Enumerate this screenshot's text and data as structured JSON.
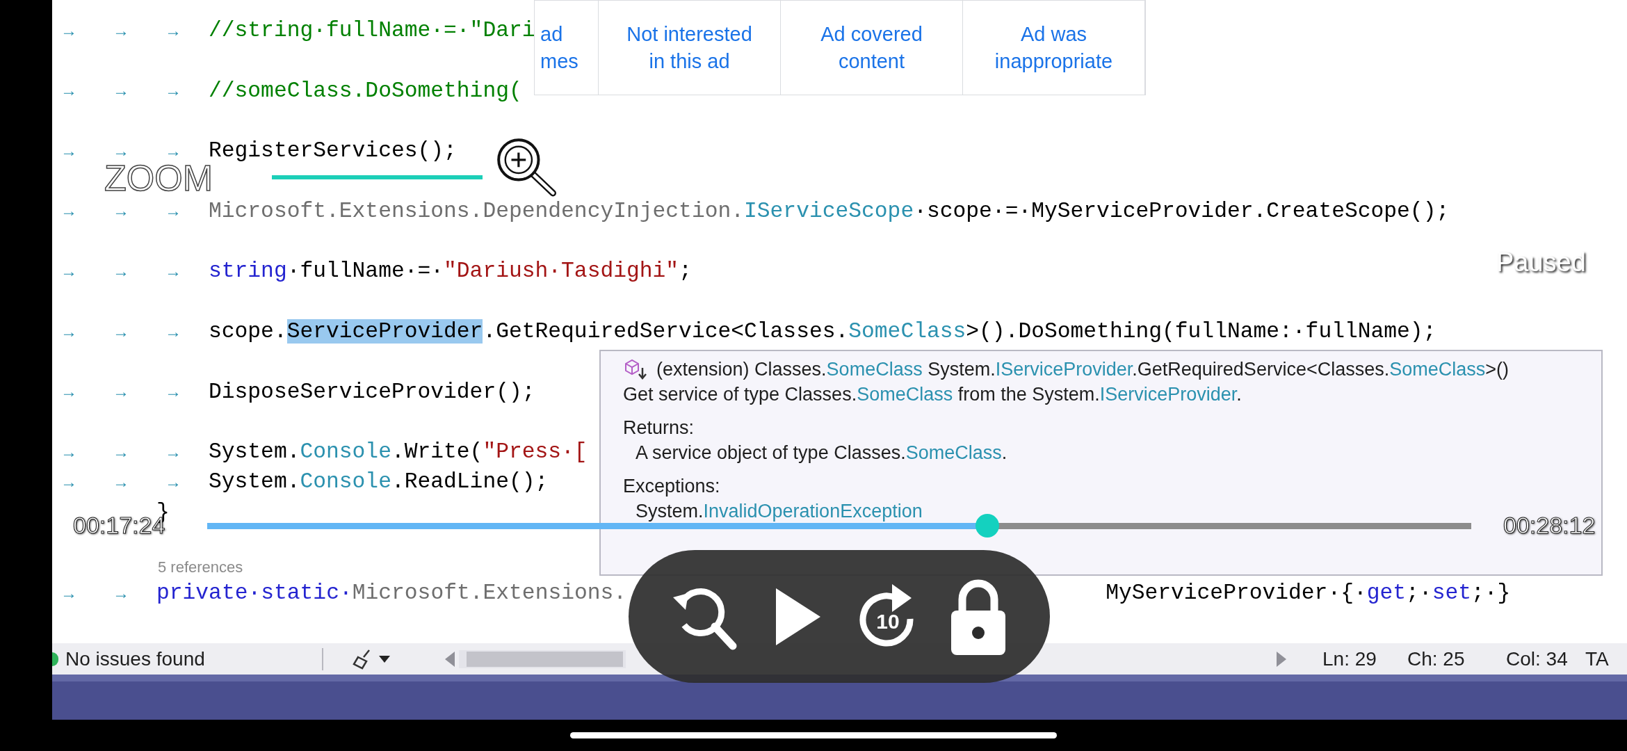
{
  "ad_feedback": {
    "options": [
      {
        "label": "ad\nmes"
      },
      {
        "label": "Not interested\nin this ad"
      },
      {
        "label": "Ad covered\ncontent"
      },
      {
        "label": "Ad was\ninappropriate"
      }
    ]
  },
  "overlay": {
    "zoom_label": "ZOOM",
    "status": "Paused"
  },
  "editor": {
    "lines": [
      {
        "kind": "code",
        "tabs": [
          "→",
          "→",
          "→"
        ],
        "segments": [
          {
            "kind": "comment",
            "text": "//string·fullName·=·\"Dari"
          }
        ]
      },
      {
        "kind": "blank"
      },
      {
        "kind": "code",
        "tabs": [
          "→",
          "→",
          "→"
        ],
        "segments": [
          {
            "kind": "comment",
            "text": "//someClass.DoSomething("
          }
        ]
      },
      {
        "kind": "blank"
      },
      {
        "kind": "code",
        "tabs": [
          "→",
          "→",
          "→"
        ],
        "segments": [
          {
            "kind": "plain",
            "text": "RegisterServices();"
          }
        ]
      },
      {
        "kind": "blank"
      },
      {
        "kind": "code",
        "tabs": [
          "→",
          "→",
          "→"
        ],
        "segments": [
          {
            "kind": "dim",
            "text": "Microsoft.Extensions.DependencyInjection."
          },
          {
            "kind": "type",
            "text": "IServiceScope"
          },
          {
            "kind": "plain",
            "text": "·scope·=·MyServiceProvider.CreateScope();"
          }
        ]
      },
      {
        "kind": "blank"
      },
      {
        "kind": "code",
        "tabs": [
          "→",
          "→",
          "→"
        ],
        "segments": [
          {
            "kind": "keyword",
            "text": "string"
          },
          {
            "kind": "plain",
            "text": "·fullName·=·"
          },
          {
            "kind": "string",
            "text": "\"Dariush·Tasdighi\""
          },
          {
            "kind": "plain",
            "text": ";"
          }
        ]
      },
      {
        "kind": "blank"
      },
      {
        "kind": "code",
        "tabs": [
          "→",
          "→",
          "→"
        ],
        "segments": [
          {
            "kind": "plain",
            "text": "scope."
          },
          {
            "kind": "selected",
            "text": "ServiceProvider"
          },
          {
            "kind": "plain",
            "text": ".GetRequiredService<Classes."
          },
          {
            "kind": "type",
            "text": "SomeClass"
          },
          {
            "kind": "plain",
            "text": ">().DoSomething(fullName:·fullName);"
          }
        ]
      },
      {
        "kind": "blank"
      },
      {
        "kind": "code",
        "tabs": [
          "→",
          "→",
          "→"
        ],
        "segments": [
          {
            "kind": "plain",
            "text": "DisposeServiceProvider();"
          }
        ]
      },
      {
        "kind": "blank"
      },
      {
        "kind": "code",
        "tabs": [
          "→",
          "→",
          "→"
        ],
        "segments": [
          {
            "kind": "plain",
            "text": "System."
          },
          {
            "kind": "type",
            "text": "Console"
          },
          {
            "kind": "plain",
            "text": ".Write("
          },
          {
            "kind": "string",
            "text": "\"Press·["
          }
        ]
      },
      {
        "kind": "code",
        "tabs": [
          "→",
          "→",
          "→"
        ],
        "segments": [
          {
            "kind": "plain",
            "text": "System."
          },
          {
            "kind": "type",
            "text": "Console"
          },
          {
            "kind": "plain",
            "text": ".ReadLine();"
          }
        ]
      },
      {
        "kind": "closing",
        "text": "}"
      },
      {
        "kind": "blank"
      },
      {
        "kind": "codelens",
        "text": "5 references"
      },
      {
        "kind": "code",
        "tabs": [
          "→",
          "→"
        ],
        "segments": [
          {
            "kind": "keyword",
            "text": "private·static·"
          },
          {
            "kind": "dim",
            "text": "Microsoft.Extensions."
          }
        ],
        "tail": [
          {
            "kind": "plain",
            "text": "MyServiceProvider·{·"
          },
          {
            "kind": "keyword",
            "text": "get"
          },
          {
            "kind": "plain",
            "text": ";·"
          },
          {
            "kind": "keyword",
            "text": "set"
          },
          {
            "kind": "plain",
            "text": ";·}"
          }
        ]
      }
    ]
  },
  "tooltip": {
    "lines": [
      {
        "kind": "signature",
        "segments": [
          {
            "kind": "plain",
            "text": "(extension) Classes."
          },
          {
            "kind": "type",
            "text": "SomeClass"
          },
          {
            "kind": "plain",
            "text": " System."
          },
          {
            "kind": "type",
            "text": "IServiceProvider"
          },
          {
            "kind": "plain",
            "text": ".GetRequiredService<Classes."
          },
          {
            "kind": "type",
            "text": "SomeClass"
          },
          {
            "kind": "plain",
            "text": ">()"
          }
        ]
      },
      {
        "kind": "text",
        "segments": [
          {
            "kind": "plain",
            "text": "Get service of type Classes."
          },
          {
            "kind": "type",
            "text": "SomeClass"
          },
          {
            "kind": "plain",
            "text": " from the System."
          },
          {
            "kind": "type",
            "text": "IServiceProvider"
          },
          {
            "kind": "plain",
            "text": "."
          }
        ]
      },
      {
        "kind": "heading",
        "segments": [
          {
            "kind": "plain",
            "text": "Returns:"
          }
        ]
      },
      {
        "kind": "indented",
        "segments": [
          {
            "kind": "plain",
            "text": "A service object of type Classes."
          },
          {
            "kind": "type",
            "text": "SomeClass"
          },
          {
            "kind": "plain",
            "text": "."
          }
        ]
      },
      {
        "kind": "heading",
        "segments": [
          {
            "kind": "plain",
            "text": "Exceptions:"
          }
        ]
      },
      {
        "kind": "indented",
        "segments": [
          {
            "kind": "plain",
            "text": "System."
          },
          {
            "kind": "type",
            "text": "InvalidOperationException"
          }
        ]
      }
    ]
  },
  "player": {
    "elapsed": "00:17:24",
    "duration": "00:28:12",
    "progress": {
      "level": 0.617
    },
    "forward_label": "10"
  },
  "status_bar": {
    "issues": "No issues found",
    "ln": "Ln: 29",
    "ch": "Ch: 25",
    "col": "Col: 34",
    "column_4": "TA"
  }
}
